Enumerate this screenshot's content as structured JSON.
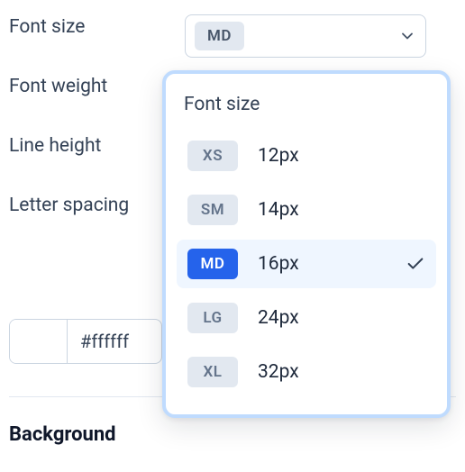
{
  "properties": {
    "font_size_label": "Font size",
    "font_weight_label": "Font weight",
    "line_height_label": "Line height",
    "letter_spacing_label": "Letter spacing",
    "background_label": "Background"
  },
  "font_size_select": {
    "selected_badge": "MD"
  },
  "color_field": {
    "value": "#ffffff"
  },
  "dropdown": {
    "title": "Font size",
    "options": [
      {
        "key": "XS",
        "value": "12px",
        "selected": false
      },
      {
        "key": "SM",
        "value": "14px",
        "selected": false
      },
      {
        "key": "MD",
        "value": "16px",
        "selected": true
      },
      {
        "key": "LG",
        "value": "24px",
        "selected": false
      },
      {
        "key": "XL",
        "value": "32px",
        "selected": false
      }
    ]
  }
}
